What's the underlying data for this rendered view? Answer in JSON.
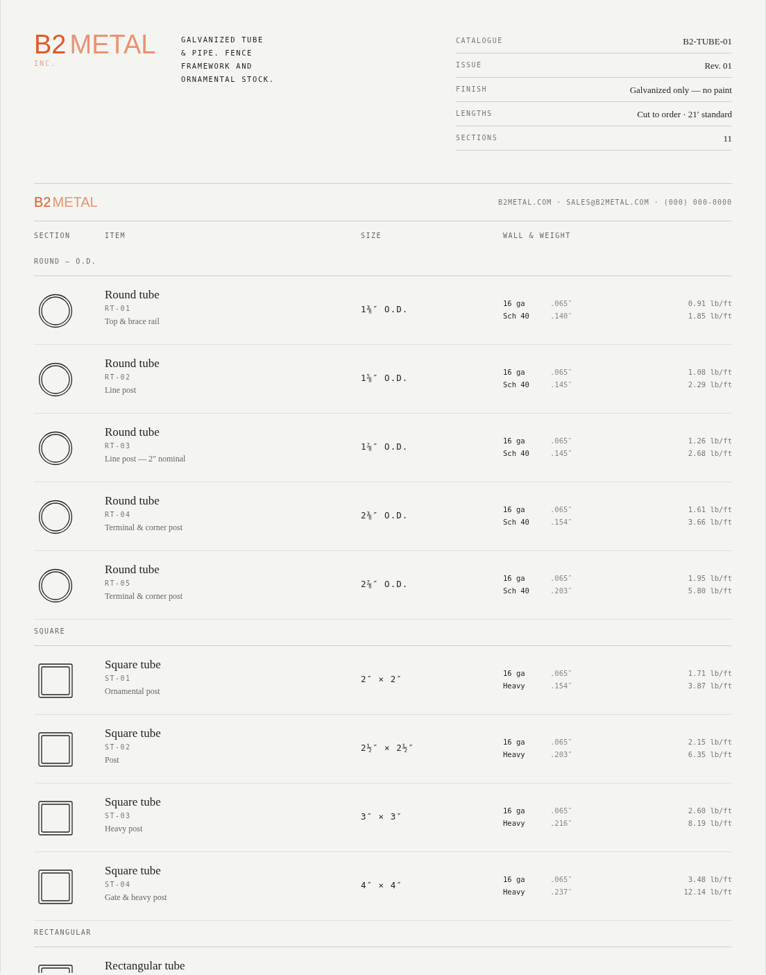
{
  "brand": {
    "mark": "B2",
    "name": "METAL",
    "suffix": "INC."
  },
  "tagline": [
    "GALVANIZED TUBE",
    "& PIPE. FENCE",
    "FRAMEWORK AND",
    "ORNAMENTAL STOCK."
  ],
  "meta": [
    {
      "label": "CATALOGUE",
      "value": "B2-TUBE-01"
    },
    {
      "label": "ISSUE",
      "value": "Rev. 01"
    },
    {
      "label": "FINISH",
      "value": "Galvanized only — no paint"
    },
    {
      "label": "LENGTHS",
      "value": "Cut to order · 21′ standard"
    },
    {
      "label": "SECTIONS",
      "value": "11"
    }
  ],
  "bar": {
    "mark": "B2",
    "name": "METAL",
    "contact": "B2METAL.COM · SALES@B2METAL.COM · (000) 000-0000"
  },
  "columns": [
    "SECTION",
    "ITEM",
    "SIZE",
    "WALL & WEIGHT"
  ],
  "sections": [
    {
      "title": "ROUND — O.D.",
      "items": [
        {
          "kind": "round",
          "name": "Round tube",
          "code": "RT-01",
          "desc": "Top & brace rail",
          "size": "1⅜″ O.D.",
          "specs": [
            {
              "gauge": "16 ga",
              "wall": ".065″",
              "weight": "0.91 lb/ft"
            },
            {
              "gauge": "Sch 40",
              "wall": ".140″",
              "weight": "1.85 lb/ft"
            }
          ]
        },
        {
          "kind": "round",
          "name": "Round tube",
          "code": "RT-02",
          "desc": "Line post",
          "size": "1⅝″ O.D.",
          "specs": [
            {
              "gauge": "16 ga",
              "wall": ".065″",
              "weight": "1.08 lb/ft"
            },
            {
              "gauge": "Sch 40",
              "wall": ".145″",
              "weight": "2.29 lb/ft"
            }
          ]
        },
        {
          "kind": "round",
          "name": "Round tube",
          "code": "RT-03",
          "desc": "Line post — 2″ nominal",
          "size": "1⅞″ O.D.",
          "specs": [
            {
              "gauge": "16 ga",
              "wall": ".065″",
              "weight": "1.26 lb/ft"
            },
            {
              "gauge": "Sch 40",
              "wall": ".145″",
              "weight": "2.68 lb/ft"
            }
          ]
        },
        {
          "kind": "round",
          "name": "Round tube",
          "code": "RT-04",
          "desc": "Terminal & corner post",
          "size": "2⅜″ O.D.",
          "specs": [
            {
              "gauge": "16 ga",
              "wall": ".065″",
              "weight": "1.61 lb/ft"
            },
            {
              "gauge": "Sch 40",
              "wall": ".154″",
              "weight": "3.66 lb/ft"
            }
          ]
        },
        {
          "kind": "round",
          "name": "Round tube",
          "code": "RT-05",
          "desc": "Terminal & corner post",
          "size": "2⅞″ O.D.",
          "specs": [
            {
              "gauge": "16 ga",
              "wall": ".065″",
              "weight": "1.95 lb/ft"
            },
            {
              "gauge": "Sch 40",
              "wall": ".203″",
              "weight": "5.80 lb/ft"
            }
          ]
        }
      ]
    },
    {
      "title": "SQUARE",
      "items": [
        {
          "kind": "square",
          "name": "Square tube",
          "code": "ST-01",
          "desc": "Ornamental post",
          "size": "2″ × 2″",
          "specs": [
            {
              "gauge": "16 ga",
              "wall": ".065″",
              "weight": "1.71 lb/ft"
            },
            {
              "gauge": "Heavy",
              "wall": ".154″",
              "weight": "3.87 lb/ft"
            }
          ]
        },
        {
          "kind": "square",
          "name": "Square tube",
          "code": "ST-02",
          "desc": "Post",
          "size": "2½″ × 2½″",
          "specs": [
            {
              "gauge": "16 ga",
              "wall": ".065″",
              "weight": "2.15 lb/ft"
            },
            {
              "gauge": "Heavy",
              "wall": ".203″",
              "weight": "6.35 lb/ft"
            }
          ]
        },
        {
          "kind": "square",
          "name": "Square tube",
          "code": "ST-03",
          "desc": "Heavy post",
          "size": "3″ × 3″",
          "specs": [
            {
              "gauge": "16 ga",
              "wall": ".065″",
              "weight": "2.60 lb/ft"
            },
            {
              "gauge": "Heavy",
              "wall": ".216″",
              "weight": "8.19 lb/ft"
            }
          ]
        },
        {
          "kind": "square",
          "name": "Square tube",
          "code": "ST-04",
          "desc": "Gate & heavy post",
          "size": "4″ × 4″",
          "specs": [
            {
              "gauge": "16 ga",
              "wall": ".065″",
              "weight": "3.48 lb/ft"
            },
            {
              "gauge": "Heavy",
              "wall": ".237″",
              "weight": "12.14 lb/ft"
            }
          ]
        }
      ]
    },
    {
      "title": "RECTANGULAR",
      "items": [
        {
          "kind": "rect",
          "name": "Rectangular tube"
        }
      ]
    }
  ]
}
